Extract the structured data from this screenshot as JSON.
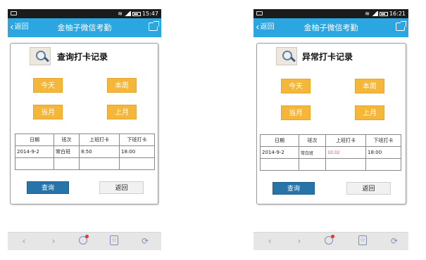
{
  "colors": {
    "accent": "#2ba6e1",
    "button_yellow": "#f4b73a",
    "query_blue": "#2674a9",
    "late_red": "#e0453d"
  },
  "screens": [
    {
      "status_time": "15:47",
      "back_label": "返回",
      "app_title": "金柚子微信考勤",
      "card_title": "查询打卡记录",
      "buttons": {
        "today": "今天",
        "this_week": "本周",
        "this_month": "当月",
        "last_month": "上月"
      },
      "table": {
        "headers": [
          "日期",
          "班次",
          "上班打卡",
          "下班打卡"
        ],
        "rows": [
          [
            "2014-9-2",
            "常白班",
            "8:50",
            "18:00"
          ]
        ]
      },
      "query_label": "查询",
      "return_label": "返回",
      "nav_icons": [
        "back-arrow-icon",
        "forward-arrow-icon",
        "bird-icon",
        "star-icon",
        "refresh-icon"
      ]
    },
    {
      "status_time": "16:21",
      "back_label": "返回",
      "app_title": "金柚子微信考勤",
      "card_title": "异常打卡记录",
      "buttons": {
        "today": "今天",
        "this_week": "本周",
        "this_month": "当月",
        "last_month": "上月"
      },
      "table": {
        "headers": [
          "日期",
          "班次",
          "上班打卡",
          "下班打卡"
        ],
        "rows": [
          [
            "2014-9-2",
            "常白班",
            "10:32",
            "18:00"
          ]
        ]
      },
      "query_label": "查询",
      "return_label": "返回",
      "nav_icons": [
        "back-arrow-icon",
        "forward-arrow-icon",
        "bird-icon",
        "star-icon",
        "refresh-icon"
      ]
    }
  ]
}
